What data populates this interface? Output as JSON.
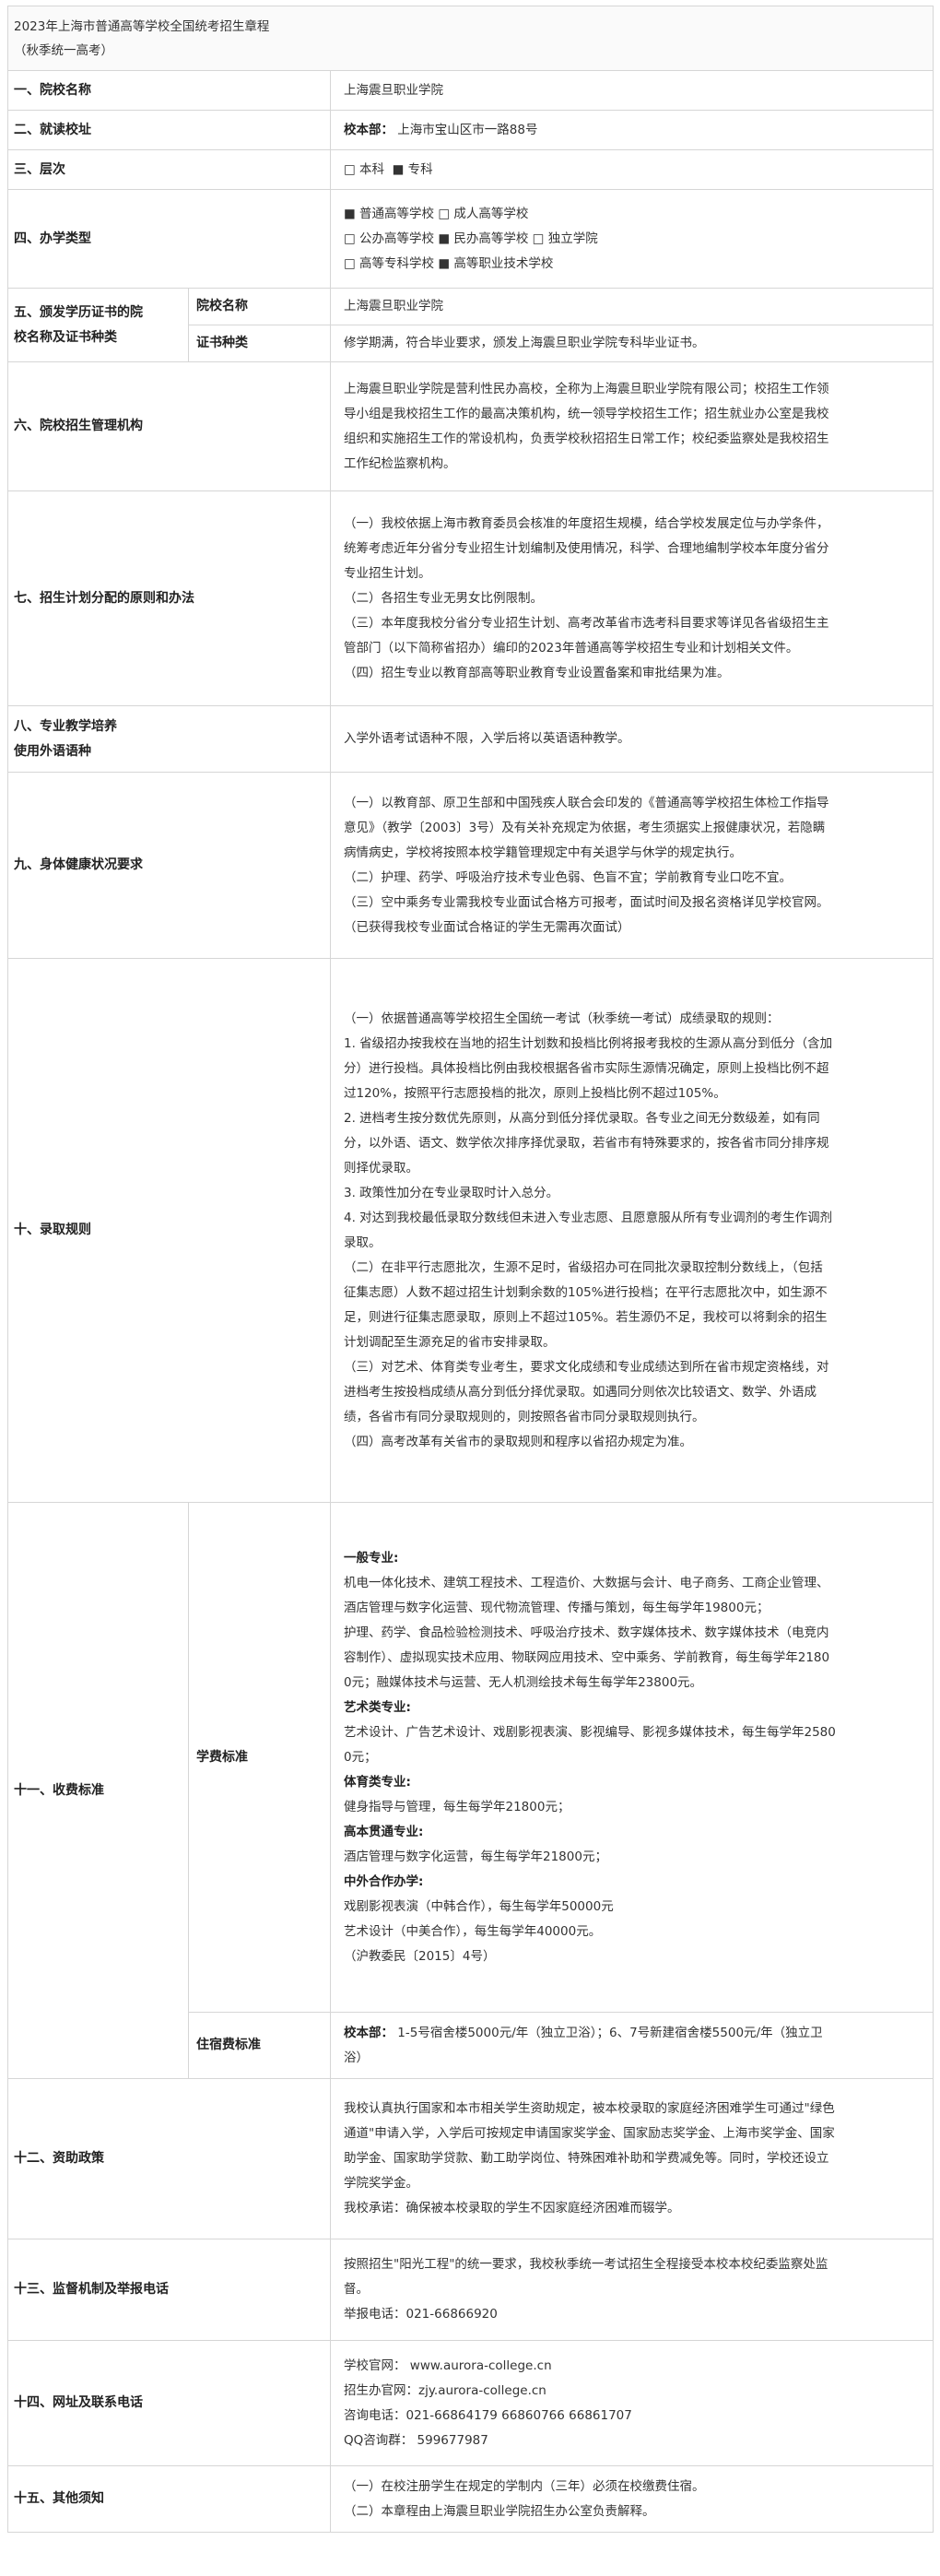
{
  "header": {
    "title": "2023年上海市普通高等学校全国统考招生章程",
    "subtitle": "（秋季统一高考）"
  },
  "rows": {
    "r1": {
      "label": "一、院校名称",
      "value": "上海震旦职业学院"
    },
    "r2": {
      "label": "二、就读校址",
      "bold": "校本部：",
      "value": "上海市宝山区市一路88号"
    },
    "r3": {
      "label": "三、层次",
      "opt1": "□ 本科",
      "opt2": "■ 专科"
    },
    "r4": {
      "label": "四、办学类型",
      "lines": [
        "■ 普通高等学校 □ 成人高等学校",
        "□ 公办高等学校 ■ 民办高等学校 □ 独立学院",
        "□ 高等专科学校 ■ 高等职业技术学校"
      ]
    },
    "r5": {
      "label1": "五、颁发学历证书的院",
      "label2": "校名称及证书种类",
      "sub1": "院校名称",
      "val1": "上海震旦职业学院",
      "sub2": "证书种类",
      "val2": "修学期满，符合毕业要求，颁发上海震旦职业学院专科毕业证书。"
    },
    "r6": {
      "label": "六、院校招生管理机构",
      "lines": [
        "上海震旦职业学院是营利性民办高校，全称为上海震旦职业学院有限公司；校招生工作领",
        "导小组是我校招生工作的最高决策机构，统一领导学校招生工作；招生就业办公室是我校",
        "组织和实施招生工作的常设机构，负责学校秋招招生日常工作；校纪委监察处是我校招生",
        "工作纪检监察机构。"
      ]
    },
    "r7": {
      "label": "七、招生计划分配的原则和办法",
      "lines": [
        "（一）我校依据上海市教育委员会核准的年度招生规模，结合学校发展定位与办学条件，",
        "统筹考虑近年分省分专业招生计划编制及使用情况，科学、合理地编制学校本年度分省分",
        "专业招生计划。",
        "（二）各招生专业无男女比例限制。",
        "（三）本年度我校分省分专业招生计划、高考改革省市选考科目要求等详见各省级招生主",
        "管部门（以下简称省招办）编印的2023年普通高等学校招生专业和计划相关文件。",
        "（四）招生专业以教育部高等职业教育专业设置备案和审批结果为准。"
      ]
    },
    "r8": {
      "label1": "八、专业教学培养",
      "label2": "使用外语语种",
      "value": "入学外语考试语种不限，入学后将以英语语种教学。"
    },
    "r9": {
      "label": "九、身体健康状况要求",
      "lines": [
        "（一）以教育部、原卫生部和中国残疾人联合会印发的《普通高等学校招生体检工作指导",
        "意见》（教学〔2003〕3号）及有关补充规定为依据，考生须据实上报健康状况，若隐瞒",
        "病情病史，学校将按照本校学籍管理规定中有关退学与休学的规定执行。",
        "（二）护理、药学、呼吸治疗技术专业色弱、色盲不宜；学前教育专业口吃不宜。",
        "（三）空中乘务专业需我校专业面试合格方可报考，面试时间及报名资格详见学校官网。",
        "（已获得我校专业面试合格证的学生无需再次面试）"
      ]
    },
    "r10": {
      "label": "十、录取规则",
      "lines": [
        "（一）依据普通高等学校招生全国统一考试（秋季统一考试）成绩录取的规则：",
        "1. 省级招办按我校在当地的招生计划数和投档比例将报考我校的生源从高分到低分（含加",
        "分）进行投档。具体投档比例由我校根据各省市实际生源情况确定，原则上投档比例不超",
        "过120%，按照平行志愿投档的批次，原则上投档比例不超过105%。",
        "2. 进档考生按分数优先原则，从高分到低分择优录取。各专业之间无分数级差，如有同",
        "分，以外语、语文、数学依次排序择优录取，若省市有特殊要求的，按各省市同分排序规",
        "则择优录取。",
        "3. 政策性加分在专业录取时计入总分。",
        "4. 对达到我校最低录取分数线但未进入专业志愿、且愿意服从所有专业调剂的考生作调剂",
        "录取。",
        "（二）在非平行志愿批次，生源不足时，省级招办可在同批次录取控制分数线上，（包括",
        "征集志愿）人数不超过招生计划剩余数的105%进行投档；在平行志愿批次中，如生源不",
        "足，则进行征集志愿录取，原则上不超过105%。若生源仍不足，我校可以将剩余的招生",
        "计划调配至生源充足的省市安排录取。",
        "（三）对艺术、体育类专业考生，要求文化成绩和专业成绩达到所在省市规定资格线，对",
        "进档考生按投档成绩从高分到低分择优录取。如遇同分则依次比较语文、数学、外语成",
        "绩，各省市有同分录取规则的，则按照各省市同分录取规则执行。",
        "（四）高考改革有关省市的录取规则和程序以省招办规定为准。"
      ]
    },
    "r11": {
      "label": "十一、收费标准",
      "sub1": "学费标准",
      "tuition": [
        {
          "t": "一般专业:",
          "bold": true
        },
        {
          "t": "机电一体化技术、建筑工程技术、工程造价、大数据与会计、电子商务、工商企业管理、"
        },
        {
          "t": "酒店管理与数字化运营、现代物流管理、传播与策划，每生每学年19800元；"
        },
        {
          "t": "护理、药学、食品检验检测技术、呼吸治疗技术、数字媒体技术、数字媒体技术（电竞内"
        },
        {
          "t": "容制作）、虚拟现实技术应用、物联网应用技术、空中乘务、学前教育，每生每学年2180"
        },
        {
          "t": "0元；融媒体技术与运营、无人机测绘技术每生每学年23800元。"
        },
        {
          "t": "艺术类专业:",
          "bold": true
        },
        {
          "t": "艺术设计、广告艺术设计、戏剧影视表演、影视编导、影视多媒体技术，每生每学年2580"
        },
        {
          "t": "0元；"
        },
        {
          "t": "体育类专业:",
          "bold": true
        },
        {
          "t": "健身指导与管理，每生每学年21800元；"
        },
        {
          "t": "高本贯通专业:",
          "bold": true
        },
        {
          "t": "酒店管理与数字化运营，每生每学年21800元；"
        },
        {
          "t": "中外合作办学:",
          "bold": true
        },
        {
          "t": "戏剧影视表演（中韩合作），每生每学年50000元"
        },
        {
          "t": "艺术设计（中美合作），每生每学年40000元。"
        },
        {
          "t": "（沪教委民〔2015〕4号）"
        }
      ],
      "sub2": "住宿费标准",
      "dorm_bold": "校本部：",
      "dorm1": "1-5号宿舍楼5000元/年（独立卫浴）；6、7号新建宿舍楼5500元/年（独立卫",
      "dorm2": "浴）"
    },
    "r12": {
      "label": "十二、资助政策",
      "lines": [
        "我校认真执行国家和本市相关学生资助规定，被本校录取的家庭经济困难学生可通过\"绿色",
        "通道\"申请入学，入学后可按规定申请国家奖学金、国家励志奖学金、上海市奖学金、国家",
        "助学金、国家助学贷款、勤工助学岗位、特殊困难补助和学费减免等。同时，学校还设立",
        "学院奖学金。",
        "我校承诺：确保被本校录取的学生不因家庭经济困难而辍学。"
      ]
    },
    "r13": {
      "label": "十三、监督机制及举报电话",
      "lines": [
        "按照招生\"阳光工程\"的统一要求，我校秋季统一考试招生全程接受本校本校纪委监察处监",
        "督。",
        "举报电话：021-66866920"
      ]
    },
    "r14": {
      "label": "十四、网址及联系电话",
      "lines": [
        "学校官网： www.aurora-college.cn",
        "招生办官网：zjy.aurora-college.cn",
        "咨询电话：021-66864179  66860766  66861707",
        "QQ咨询群： 599677987"
      ]
    },
    "r15": {
      "label": "十五、其他须知",
      "lines": [
        "（一）在校注册学生在规定的学制内（三年）必须在校缴费住宿。",
        "（二）本章程由上海震旦职业学院招生办公室负责解释。"
      ]
    }
  }
}
